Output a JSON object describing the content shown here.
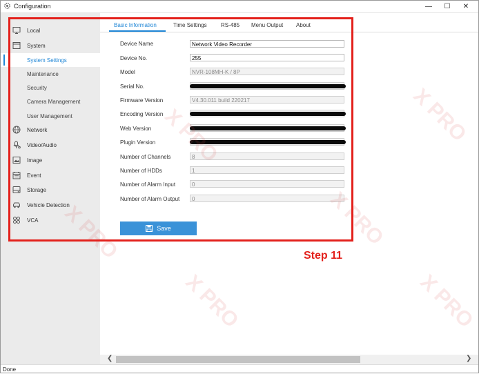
{
  "window": {
    "title": "Configuration",
    "minimize": "—",
    "maximize": "☐",
    "close": "✕"
  },
  "sidebar": {
    "items": [
      {
        "label": "Local",
        "icon": "monitor-icon"
      },
      {
        "label": "System",
        "icon": "system-icon"
      },
      {
        "label": "System Settings",
        "active": true
      },
      {
        "label": "Maintenance"
      },
      {
        "label": "Security"
      },
      {
        "label": "Camera Management"
      },
      {
        "label": "User Management"
      },
      {
        "label": "Network",
        "icon": "globe-icon"
      },
      {
        "label": "Video/Audio",
        "icon": "microphone-icon"
      },
      {
        "label": "Image",
        "icon": "image-icon"
      },
      {
        "label": "Event",
        "icon": "calendar-icon"
      },
      {
        "label": "Storage",
        "icon": "storage-icon"
      },
      {
        "label": "Vehicle Detection",
        "icon": "vehicle-icon"
      },
      {
        "label": "VCA",
        "icon": "vca-icon"
      }
    ]
  },
  "tabs": [
    "Basic Information",
    "Time Settings",
    "RS-485",
    "Menu Output",
    "About"
  ],
  "form": {
    "device_name_label": "Device Name",
    "device_name_value": "Network Video Recorder",
    "device_no_label": "Device No.",
    "device_no_value": "255",
    "model_label": "Model",
    "model_value": "NVR-108MH-K / 8P",
    "serial_label": "Serial No.",
    "firmware_label": "Firmware Version",
    "firmware_value": "V4.30.011 build 220217",
    "encoding_label": "Encoding Version",
    "web_label": "Web Version",
    "plugin_label": "Plugin Version",
    "channels_label": "Number of Channels",
    "channels_value": "8",
    "hdds_label": "Number of HDDs",
    "hdds_value": "1",
    "alarm_in_label": "Number of Alarm Input",
    "alarm_in_value": "0",
    "alarm_out_label": "Number of Alarm Output",
    "alarm_out_value": "0",
    "save_label": "Save"
  },
  "annotation": {
    "step_label": "Step 11",
    "color": "#e3201b"
  },
  "status": {
    "text": "Done"
  },
  "colors": {
    "accent": "#1f86d6",
    "save_button": "#3a92d8",
    "sidebar_bg": "#ebebeb"
  }
}
